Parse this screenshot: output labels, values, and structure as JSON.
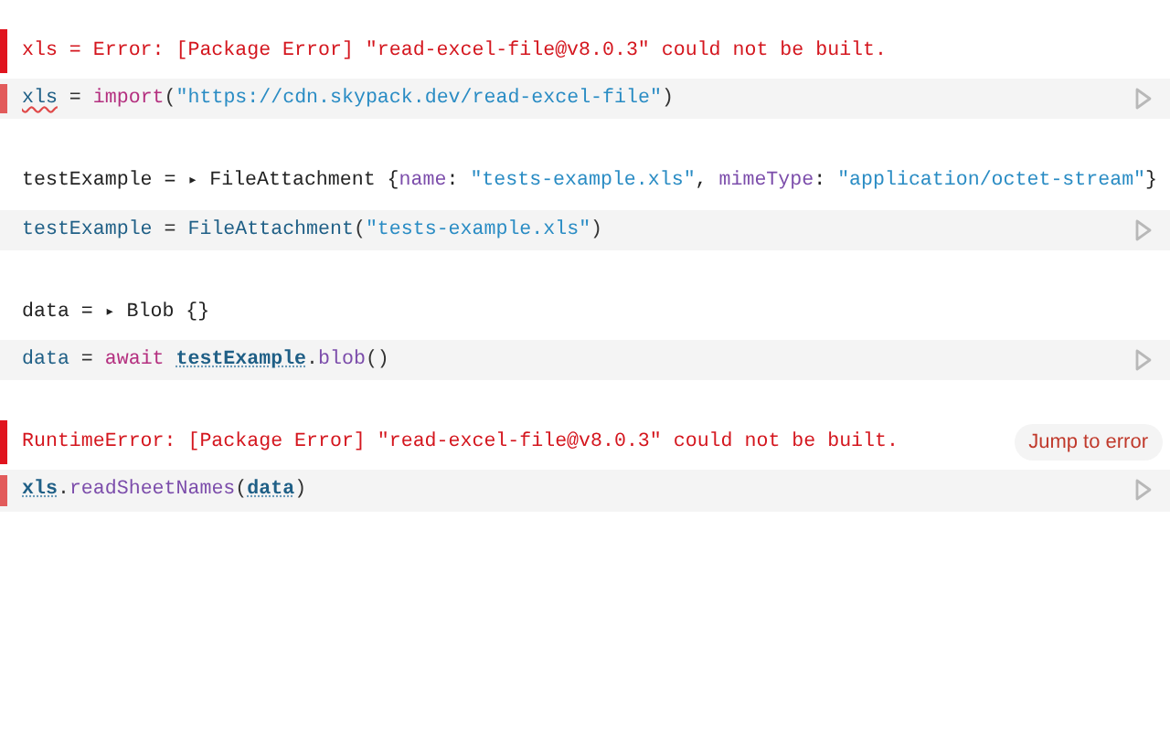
{
  "cells": [
    {
      "error": true,
      "output": [
        {
          "text": "xls = Error: [Package Error] \"read-excel-file@v8.0.3\" could not be built.",
          "kind": "error"
        }
      ],
      "code": [
        {
          "text": "xls",
          "kind": "name",
          "flagged": true
        },
        {
          "text": " = ",
          "kind": "punct"
        },
        {
          "text": "import",
          "kind": "keyword"
        },
        {
          "text": "(",
          "kind": "punct"
        },
        {
          "text": "\"https://cdn.skypack.dev/read-excel-file\"",
          "kind": "string"
        },
        {
          "text": ")",
          "kind": "punct"
        }
      ]
    },
    {
      "error": false,
      "output": [
        {
          "text": "testExample = ",
          "kind": "plain"
        },
        {
          "text": "▸",
          "kind": "toggle"
        },
        {
          "text": " FileAttachment {",
          "kind": "plain"
        },
        {
          "text": "name",
          "kind": "key"
        },
        {
          "text": ": ",
          "kind": "plain"
        },
        {
          "text": "\"tests-example.xls\"",
          "kind": "string"
        },
        {
          "text": ", ",
          "kind": "plain"
        },
        {
          "text": "mimeType",
          "kind": "key"
        },
        {
          "text": ": ",
          "kind": "plain"
        },
        {
          "text": "\"application/octet-stream\"",
          "kind": "string"
        },
        {
          "text": "}",
          "kind": "plain"
        }
      ],
      "code": [
        {
          "text": "testExample",
          "kind": "name"
        },
        {
          "text": " = ",
          "kind": "punct"
        },
        {
          "text": "FileAttachment",
          "kind": "name"
        },
        {
          "text": "(",
          "kind": "punct"
        },
        {
          "text": "\"tests-example.xls\"",
          "kind": "string"
        },
        {
          "text": ")",
          "kind": "punct"
        }
      ]
    },
    {
      "error": false,
      "output": [
        {
          "text": "data = ",
          "kind": "plain"
        },
        {
          "text": "▸",
          "kind": "toggle"
        },
        {
          "text": " Blob {}",
          "kind": "plain"
        }
      ],
      "code": [
        {
          "text": "data",
          "kind": "name"
        },
        {
          "text": " = ",
          "kind": "punct"
        },
        {
          "text": "await ",
          "kind": "keyword"
        },
        {
          "text": "testExample",
          "kind": "ref",
          "linked": true
        },
        {
          "text": ".",
          "kind": "punct"
        },
        {
          "text": "blob",
          "kind": "method"
        },
        {
          "text": "()",
          "kind": "punct"
        }
      ]
    },
    {
      "error": true,
      "jump_button": "Jump to error",
      "output": [
        {
          "text": "RuntimeError: [Package Error] \"read-excel-file@v8.0.3\" could not be built.",
          "kind": "error"
        }
      ],
      "code": [
        {
          "text": "xls",
          "kind": "ref",
          "linked": true
        },
        {
          "text": ".",
          "kind": "punct"
        },
        {
          "text": "readSheetNames",
          "kind": "method"
        },
        {
          "text": "(",
          "kind": "punct"
        },
        {
          "text": "data",
          "kind": "ref",
          "linked": true
        },
        {
          "text": ")",
          "kind": "punct"
        }
      ]
    }
  ]
}
